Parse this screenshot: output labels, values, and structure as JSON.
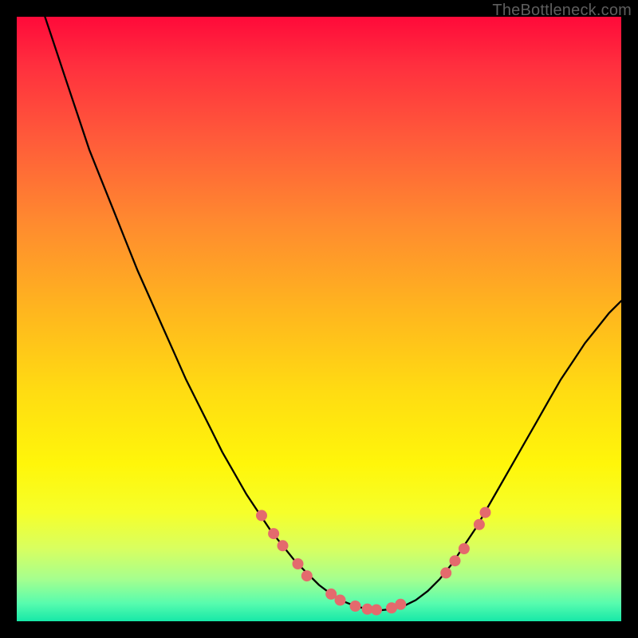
{
  "watermark": "TheBottleneck.com",
  "gradient": {
    "stops": [
      {
        "pos": 0.0,
        "color": "#ff0a3a"
      },
      {
        "pos": 0.08,
        "color": "#ff2f3e"
      },
      {
        "pos": 0.2,
        "color": "#ff5a3a"
      },
      {
        "pos": 0.34,
        "color": "#ff8a2f"
      },
      {
        "pos": 0.48,
        "color": "#ffb41f"
      },
      {
        "pos": 0.62,
        "color": "#ffdc12"
      },
      {
        "pos": 0.74,
        "color": "#fff60a"
      },
      {
        "pos": 0.82,
        "color": "#f6ff2a"
      },
      {
        "pos": 0.88,
        "color": "#d8ff60"
      },
      {
        "pos": 0.93,
        "color": "#a6ff8e"
      },
      {
        "pos": 0.97,
        "color": "#58fcae"
      },
      {
        "pos": 1.0,
        "color": "#17e8a8"
      }
    ]
  },
  "curve_style": {
    "stroke": "#000000",
    "stroke_width": 2.3
  },
  "marker_style": {
    "fill": "#e46a6d",
    "radius": 7
  },
  "chart_data": {
    "type": "line",
    "title": "",
    "xlabel": "",
    "ylabel": "",
    "xlim": [
      0,
      100
    ],
    "ylim": [
      0,
      100
    ],
    "series": [
      {
        "name": "bottleneck-curve",
        "x": [
          4,
          6,
          8,
          10,
          12,
          14,
          16,
          18,
          20,
          22,
          24,
          26,
          28,
          30,
          32,
          34,
          36,
          38,
          40,
          42,
          44,
          46,
          48,
          50,
          52,
          54,
          56,
          58,
          60,
          62,
          64,
          66,
          68,
          70,
          72,
          74,
          76,
          78,
          80,
          82,
          84,
          86,
          88,
          90,
          92,
          94,
          96,
          98,
          100
        ],
        "y": [
          102,
          96,
          90,
          84,
          78,
          73,
          68,
          63,
          58,
          53.5,
          49,
          44.5,
          40,
          36,
          32,
          28,
          24.5,
          21,
          18,
          15,
          12.5,
          10,
          8,
          6,
          4.5,
          3.3,
          2.5,
          2,
          1.8,
          2,
          2.5,
          3.5,
          5,
          7,
          9.5,
          12.5,
          15.5,
          19,
          22.5,
          26,
          29.5,
          33,
          36.5,
          40,
          43,
          46,
          48.5,
          51,
          53
        ]
      }
    ],
    "markers": {
      "name": "highlight-dots",
      "points": [
        {
          "x": 40.5,
          "y": 17.5
        },
        {
          "x": 42.5,
          "y": 14.5
        },
        {
          "x": 44.0,
          "y": 12.5
        },
        {
          "x": 46.5,
          "y": 9.5
        },
        {
          "x": 48.0,
          "y": 7.5
        },
        {
          "x": 52.0,
          "y": 4.5
        },
        {
          "x": 53.5,
          "y": 3.5
        },
        {
          "x": 56.0,
          "y": 2.5
        },
        {
          "x": 58.0,
          "y": 2.0
        },
        {
          "x": 59.5,
          "y": 1.9
        },
        {
          "x": 62.0,
          "y": 2.2
        },
        {
          "x": 63.5,
          "y": 2.8
        },
        {
          "x": 71.0,
          "y": 8.0
        },
        {
          "x": 72.5,
          "y": 10.0
        },
        {
          "x": 74.0,
          "y": 12.0
        },
        {
          "x": 76.5,
          "y": 16.0
        },
        {
          "x": 77.5,
          "y": 18.0
        }
      ]
    }
  }
}
